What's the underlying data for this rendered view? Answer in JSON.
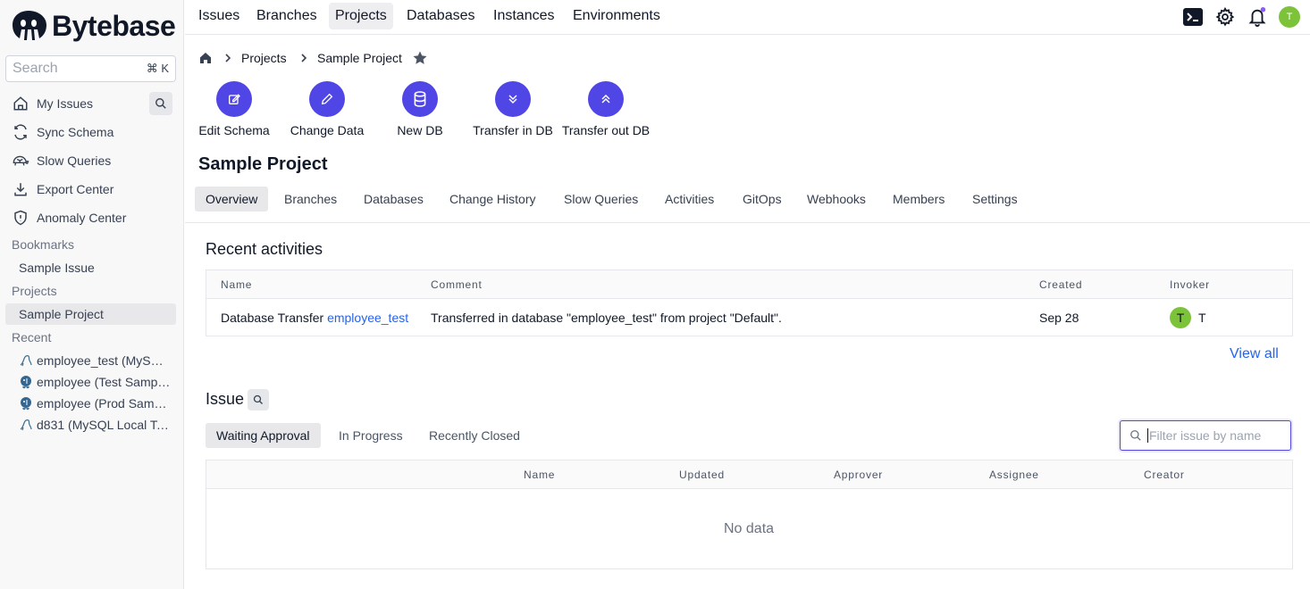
{
  "app": {
    "name": "Bytebase"
  },
  "search": {
    "placeholder": "Search",
    "shortcut": "⌘ K"
  },
  "sidebar": {
    "items": [
      {
        "label": "My Issues",
        "icon": "home-icon"
      },
      {
        "label": "Sync Schema",
        "icon": "sync-icon"
      },
      {
        "label": "Slow Queries",
        "icon": "turtle-icon"
      },
      {
        "label": "Export Center",
        "icon": "download-icon"
      },
      {
        "label": "Anomaly Center",
        "icon": "shield-icon"
      }
    ],
    "bookmarks_label": "Bookmarks",
    "bookmarks": [
      "Sample Issue"
    ],
    "projects_label": "Projects",
    "projects": [
      "Sample Project"
    ],
    "recent_label": "Recent",
    "recent": [
      {
        "label": "employee_test (MySQL Local Test)",
        "icon": "mysql-icon"
      },
      {
        "label": "employee (Test Sample Instance)",
        "icon": "postgres-icon"
      },
      {
        "label": "employee (Prod Sample Instance)",
        "icon": "postgres-icon"
      },
      {
        "label": "d831 (MySQL Local Test)",
        "icon": "mysql-icon"
      }
    ]
  },
  "topnav": {
    "items": [
      "Issues",
      "Branches",
      "Projects",
      "Databases",
      "Instances",
      "Environments"
    ],
    "active": "Projects",
    "avatar": "T"
  },
  "breadcrumb": {
    "items": [
      "Projects",
      "Sample Project"
    ]
  },
  "quick_actions": [
    "Edit Schema",
    "Change Data",
    "New DB",
    "Transfer in DB",
    "Transfer out DB"
  ],
  "project": {
    "title": "Sample Project"
  },
  "tabs": {
    "items": [
      "Overview",
      "Branches",
      "Databases",
      "Change History",
      "Slow Queries",
      "Activities",
      "GitOps",
      "Webhooks",
      "Members",
      "Settings"
    ],
    "active": "Overview"
  },
  "activities": {
    "title": "Recent activities",
    "columns": [
      "Name",
      "Comment",
      "Created",
      "Invoker"
    ],
    "rows": [
      {
        "name_prefix": "Database Transfer",
        "name_link": "employee_test",
        "comment": "Transferred in database \"employee_test\" from project \"Default\".",
        "created": "Sep 28",
        "invoker_avatar": "T",
        "invoker": "T"
      }
    ],
    "view_all": "View all"
  },
  "issues": {
    "title": "Issue",
    "tabs": [
      "Waiting Approval",
      "In Progress",
      "Recently Closed"
    ],
    "active_tab": "Waiting Approval",
    "filter_placeholder": "Filter issue by name",
    "columns": [
      "Name",
      "Updated",
      "Approver",
      "Assignee",
      "Creator"
    ],
    "empty_text": "No data"
  },
  "colors": {
    "accent": "#4f46e5",
    "link": "#2563eb",
    "avatar": "#7cc33a"
  }
}
